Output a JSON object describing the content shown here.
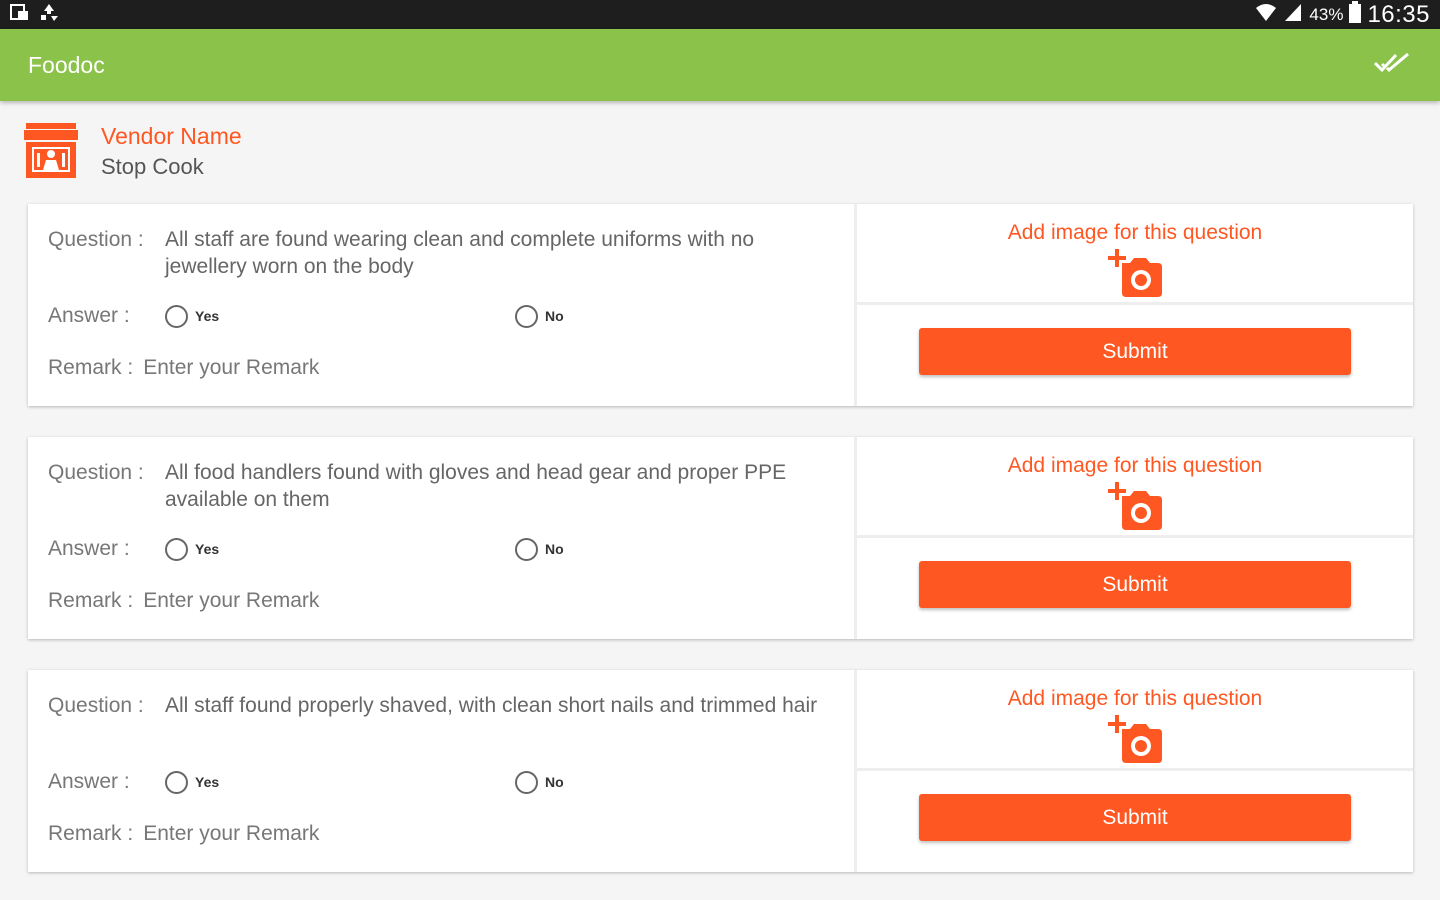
{
  "status_bar": {
    "battery_text": "43%",
    "time": "16:35",
    "icons": [
      "gallery-icon",
      "recycle-icon",
      "wifi-icon",
      "signal-icon",
      "battery-icon"
    ]
  },
  "app_bar": {
    "title": "Foodoc",
    "action_icon": "done-all-icon"
  },
  "vendor": {
    "icon": "store-icon",
    "label": "Vendor Name",
    "value": "Stop Cook"
  },
  "labels": {
    "question": "Question :",
    "answer": "Answer :",
    "remark": "Remark :",
    "remark_placeholder": "Enter your Remark",
    "yes": "Yes",
    "no": "No",
    "add_image": "Add image for this question",
    "submit": "Submit"
  },
  "questions": [
    {
      "text": "All staff are found wearing clean and complete uniforms with no jewellery worn on the body",
      "remark": ""
    },
    {
      "text": "All food handlers found with gloves and head gear and proper PPE available on them",
      "remark": ""
    },
    {
      "text": "All staff found properly shaved, with clean short nails and trimmed hair",
      "remark": ""
    }
  ],
  "colors": {
    "app_bar": "#8bc34a",
    "accent": "#ff5722",
    "status_bar": "#1e1e1e"
  }
}
